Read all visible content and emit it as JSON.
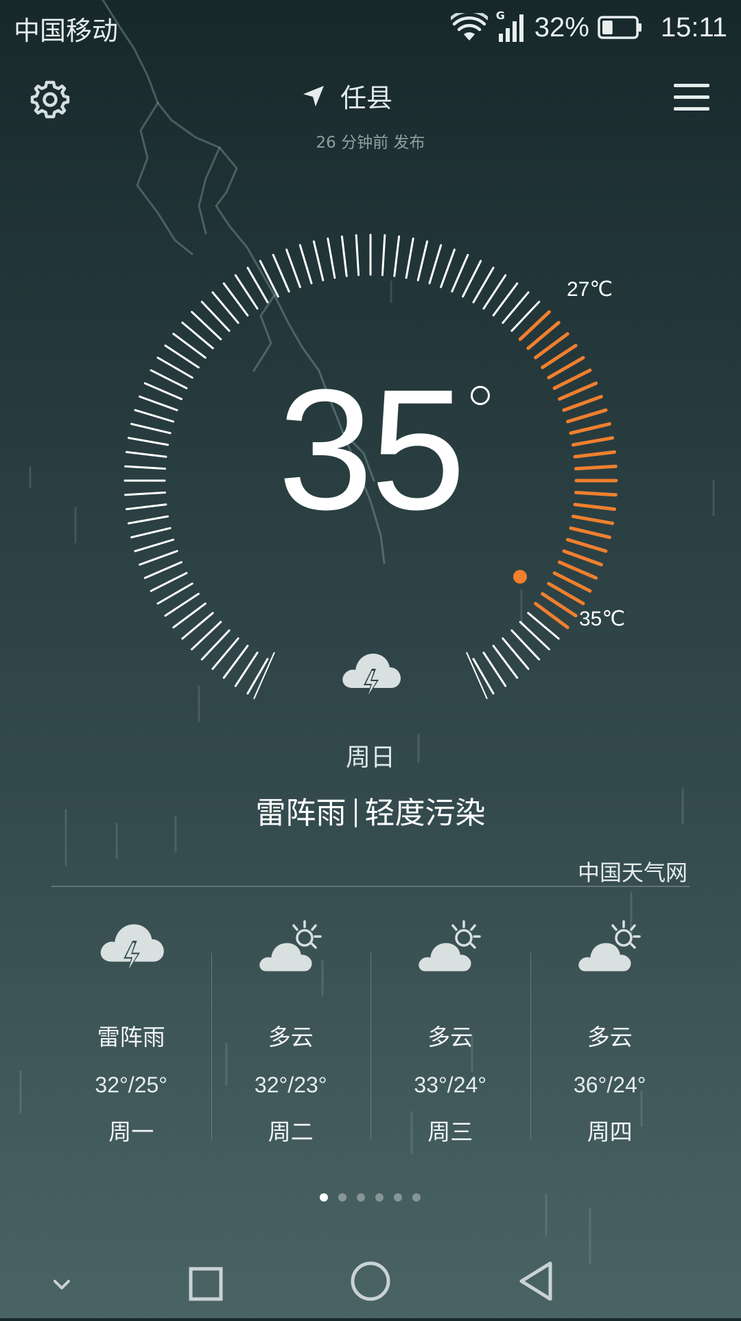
{
  "status_bar": {
    "carrier": "中国移动",
    "network_type": "G",
    "battery_percent": "32%",
    "battery_level": 0.32,
    "time": "15:11",
    "icons": [
      "wifi-icon",
      "signal-icon",
      "battery-icon"
    ]
  },
  "header": {
    "location": "任县",
    "publish_time": "26 分钟前 发布",
    "icons": [
      "settings-gear-icon",
      "location-arrow-icon",
      "menu-icon"
    ]
  },
  "current": {
    "temperature": "35",
    "range_high_label": "27℃",
    "range_low_label": "35℃",
    "weather_icon": "thunderstorm-icon",
    "day": "周日",
    "condition": "雷阵雨",
    "air_quality": "轻度污染"
  },
  "source": "中国天气网",
  "forecast": [
    {
      "condition": "雷阵雨",
      "temps": "32°/25°",
      "day": "周一",
      "icon": "thunderstorm-icon"
    },
    {
      "condition": "多云",
      "temps": "32°/23°",
      "day": "周二",
      "icon": "partly-cloudy-icon"
    },
    {
      "condition": "多云",
      "temps": "33°/24°",
      "day": "周三",
      "icon": "partly-cloudy-icon"
    },
    {
      "condition": "多云",
      "temps": "36°/24°",
      "day": "周四",
      "icon": "partly-cloudy-icon"
    }
  ],
  "pagination": {
    "total": 6,
    "active": 1
  },
  "nav_bar": {
    "icons": [
      "collapse-chevron-icon",
      "recents-square-icon",
      "home-circle-icon",
      "back-triangle-icon"
    ]
  },
  "colors": {
    "accent": "#f07f2e",
    "tick": "#ffffff",
    "bg_top": "#17282a",
    "bg_bottom": "#4a6364"
  }
}
